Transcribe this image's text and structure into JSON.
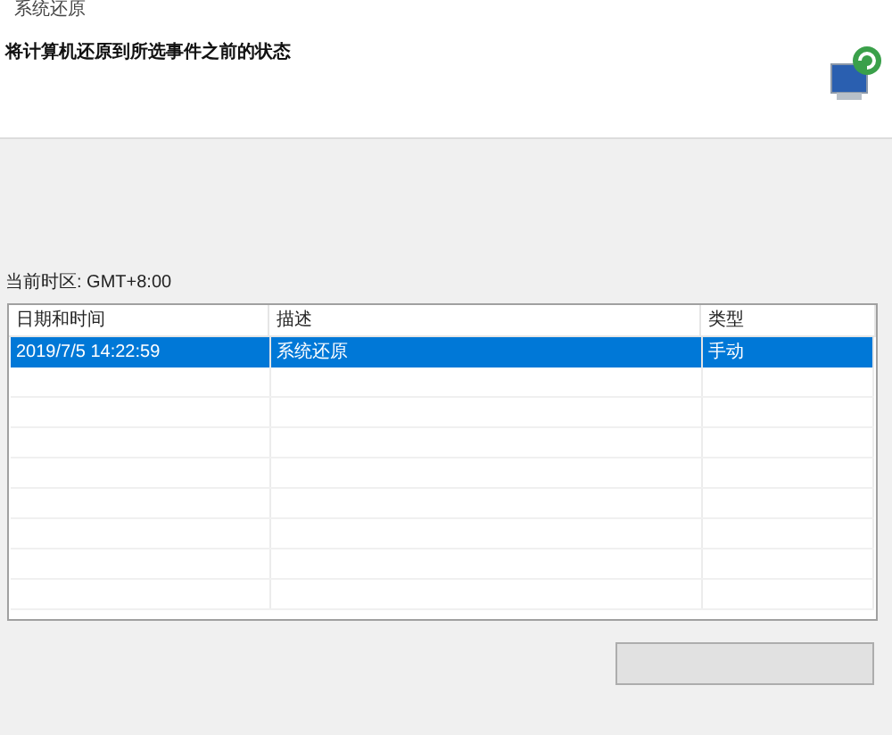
{
  "window": {
    "title": "系统还原"
  },
  "heading": "将计算机还原到所选事件之前的状态",
  "timezone": "当前时区: GMT+8:00",
  "table": {
    "columns": [
      "日期和时间",
      "描述",
      "类型"
    ],
    "rows": [
      {
        "cells": [
          "2019/7/5 14:22:59",
          "系统还原",
          "手动"
        ],
        "selected": true
      }
    ]
  }
}
